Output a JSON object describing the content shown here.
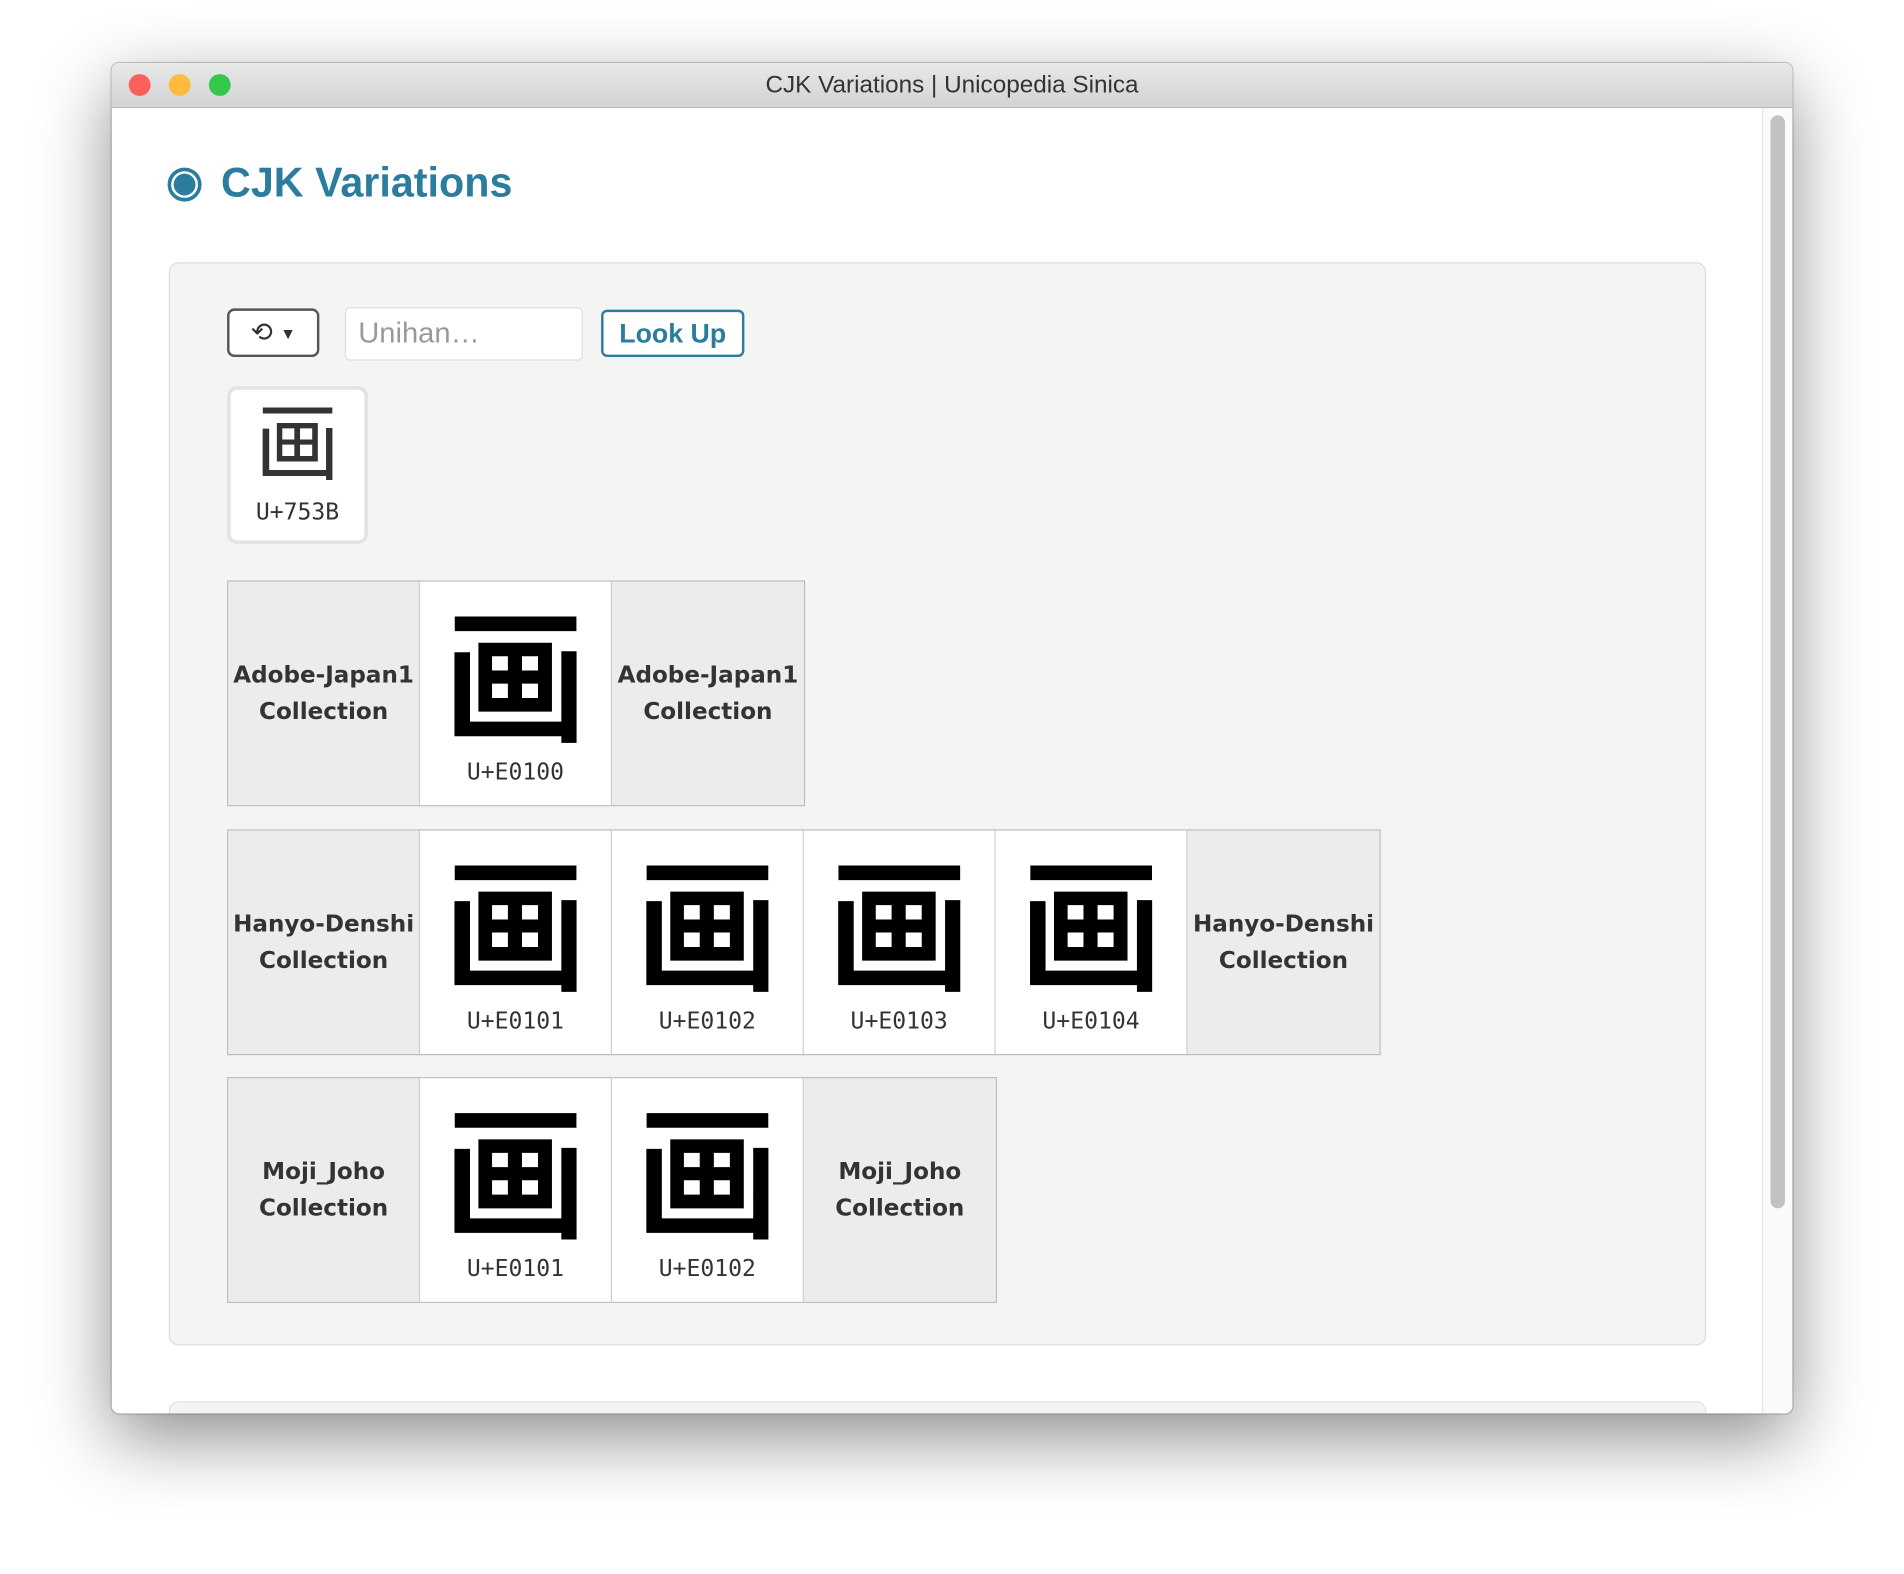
{
  "window": {
    "title": "CJK Variations | Unicopedia Sinica"
  },
  "header": {
    "title": "CJK Variations"
  },
  "controls": {
    "history_icon": "history-icon",
    "input_placeholder": "Unihan…",
    "input_value": "",
    "lookup_label": "Look Up"
  },
  "character": {
    "glyph": "画",
    "code": "U+753B"
  },
  "collections": [
    {
      "label": "Adobe-Japan1 Collection",
      "variants": [
        {
          "glyph": "画",
          "code": "U+E0100"
        }
      ]
    },
    {
      "label": "Hanyo-Denshi Collection",
      "variants": [
        {
          "glyph": "画",
          "code": "U+E0101"
        },
        {
          "glyph": "画",
          "code": "U+E0102"
        },
        {
          "glyph": "画",
          "code": "U+E0103"
        },
        {
          "glyph": "画",
          "code": "U+E0104"
        }
      ]
    },
    {
      "label": "Moji_Joho Collection",
      "variants": [
        {
          "glyph": "画",
          "code": "U+E0101"
        },
        {
          "glyph": "画",
          "code": "U+E0102"
        }
      ]
    }
  ],
  "colors": {
    "accent": "#2a7d9e",
    "close": "#fc605c",
    "minimize": "#fdbc40",
    "zoom": "#34c84a"
  }
}
